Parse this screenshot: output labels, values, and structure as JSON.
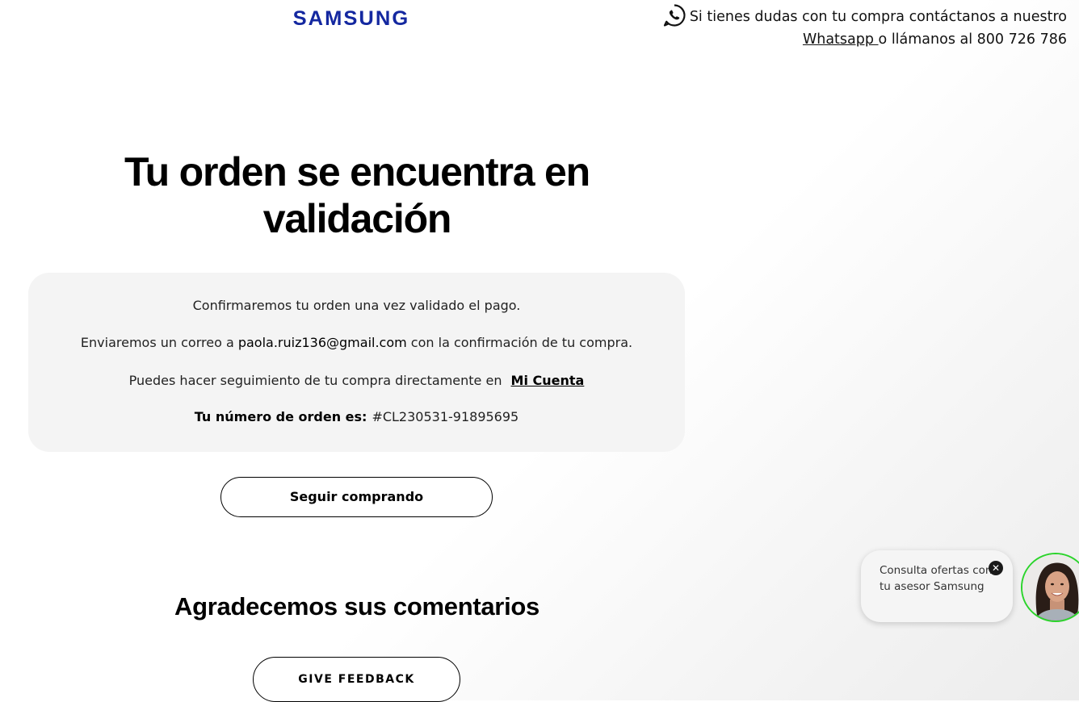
{
  "header": {
    "logo_text": "SAMSUNG",
    "contact_text_1": "Si tienes dudas con tu compra contáctanos a nuestro",
    "whatsapp_link": "Whatsapp ",
    "contact_text_2": "o llámanos al 800 726 786"
  },
  "main": {
    "title": "Tu orden se encuentra en validación",
    "card": {
      "line1": "Confirmaremos tu orden una vez validado el pago.",
      "line2_prefix": "Enviaremos un correo a ",
      "email": "paola.ruiz136@gmail.com",
      "line2_suffix": " con la confirmación de tu compra.",
      "line3_prefix": "Puedes hacer seguimiento de tu compra directamente en ",
      "account_link": "Mi Cuenta",
      "order_label": "Tu número de orden es:",
      "order_number": "#CL230531-91895695"
    },
    "continue_button": "Seguir comprando"
  },
  "feedback": {
    "title": "Agradecemos sus comentarios",
    "button": "GIVE FEEDBACK"
  },
  "chat_widget": {
    "bubble_text": "Consulta ofertas con tu asesor Samsung",
    "close_symbol": "✕",
    "avatar_icon": "advisor-avatar-icon",
    "status_color": "#2bd42b"
  },
  "colors": {
    "brand_blue": "#1428a0",
    "whatsapp_icon": "#111111"
  }
}
